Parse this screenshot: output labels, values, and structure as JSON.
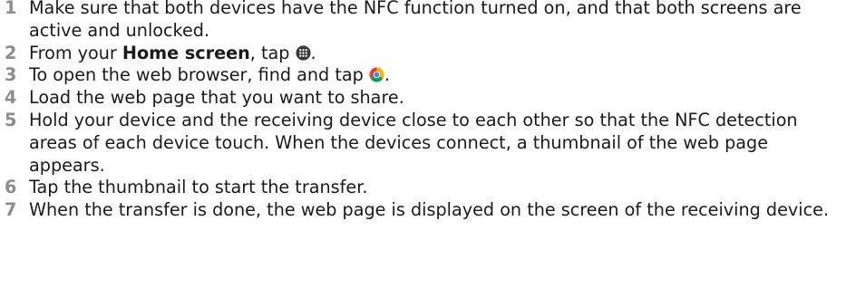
{
  "steps": [
    {
      "number": "1",
      "text": "Make sure that both devices have the NFC function turned on, and that both screens are active and unlocked."
    },
    {
      "number": "2",
      "text_before": "From your ",
      "bold": "Home screen",
      "text_middle": ", tap ",
      "icon": "apps-grid-icon",
      "text_after": "."
    },
    {
      "number": "3",
      "text_before": "To open the web browser, find and tap ",
      "icon": "chrome-icon",
      "text_after": "."
    },
    {
      "number": "4",
      "text": "Load the web page that you want to share."
    },
    {
      "number": "5",
      "text": "Hold your device and the receiving device close to each other so that the NFC detection areas of each device touch. When the devices connect, a thumbnail of the web page appears."
    },
    {
      "number": "6",
      "text": "Tap the thumbnail to start the transfer."
    },
    {
      "number": "7",
      "text": "When the transfer is done, the web page is displayed on the screen of the receiving device."
    }
  ],
  "colors": {
    "step_number": "#8c8c8c",
    "text": "#1a1a1a",
    "apps_icon": "#3a3a3a",
    "chrome_red": "#db4437",
    "chrome_yellow": "#f4b400",
    "chrome_green": "#0f9d58",
    "chrome_blue": "#4285f4"
  }
}
